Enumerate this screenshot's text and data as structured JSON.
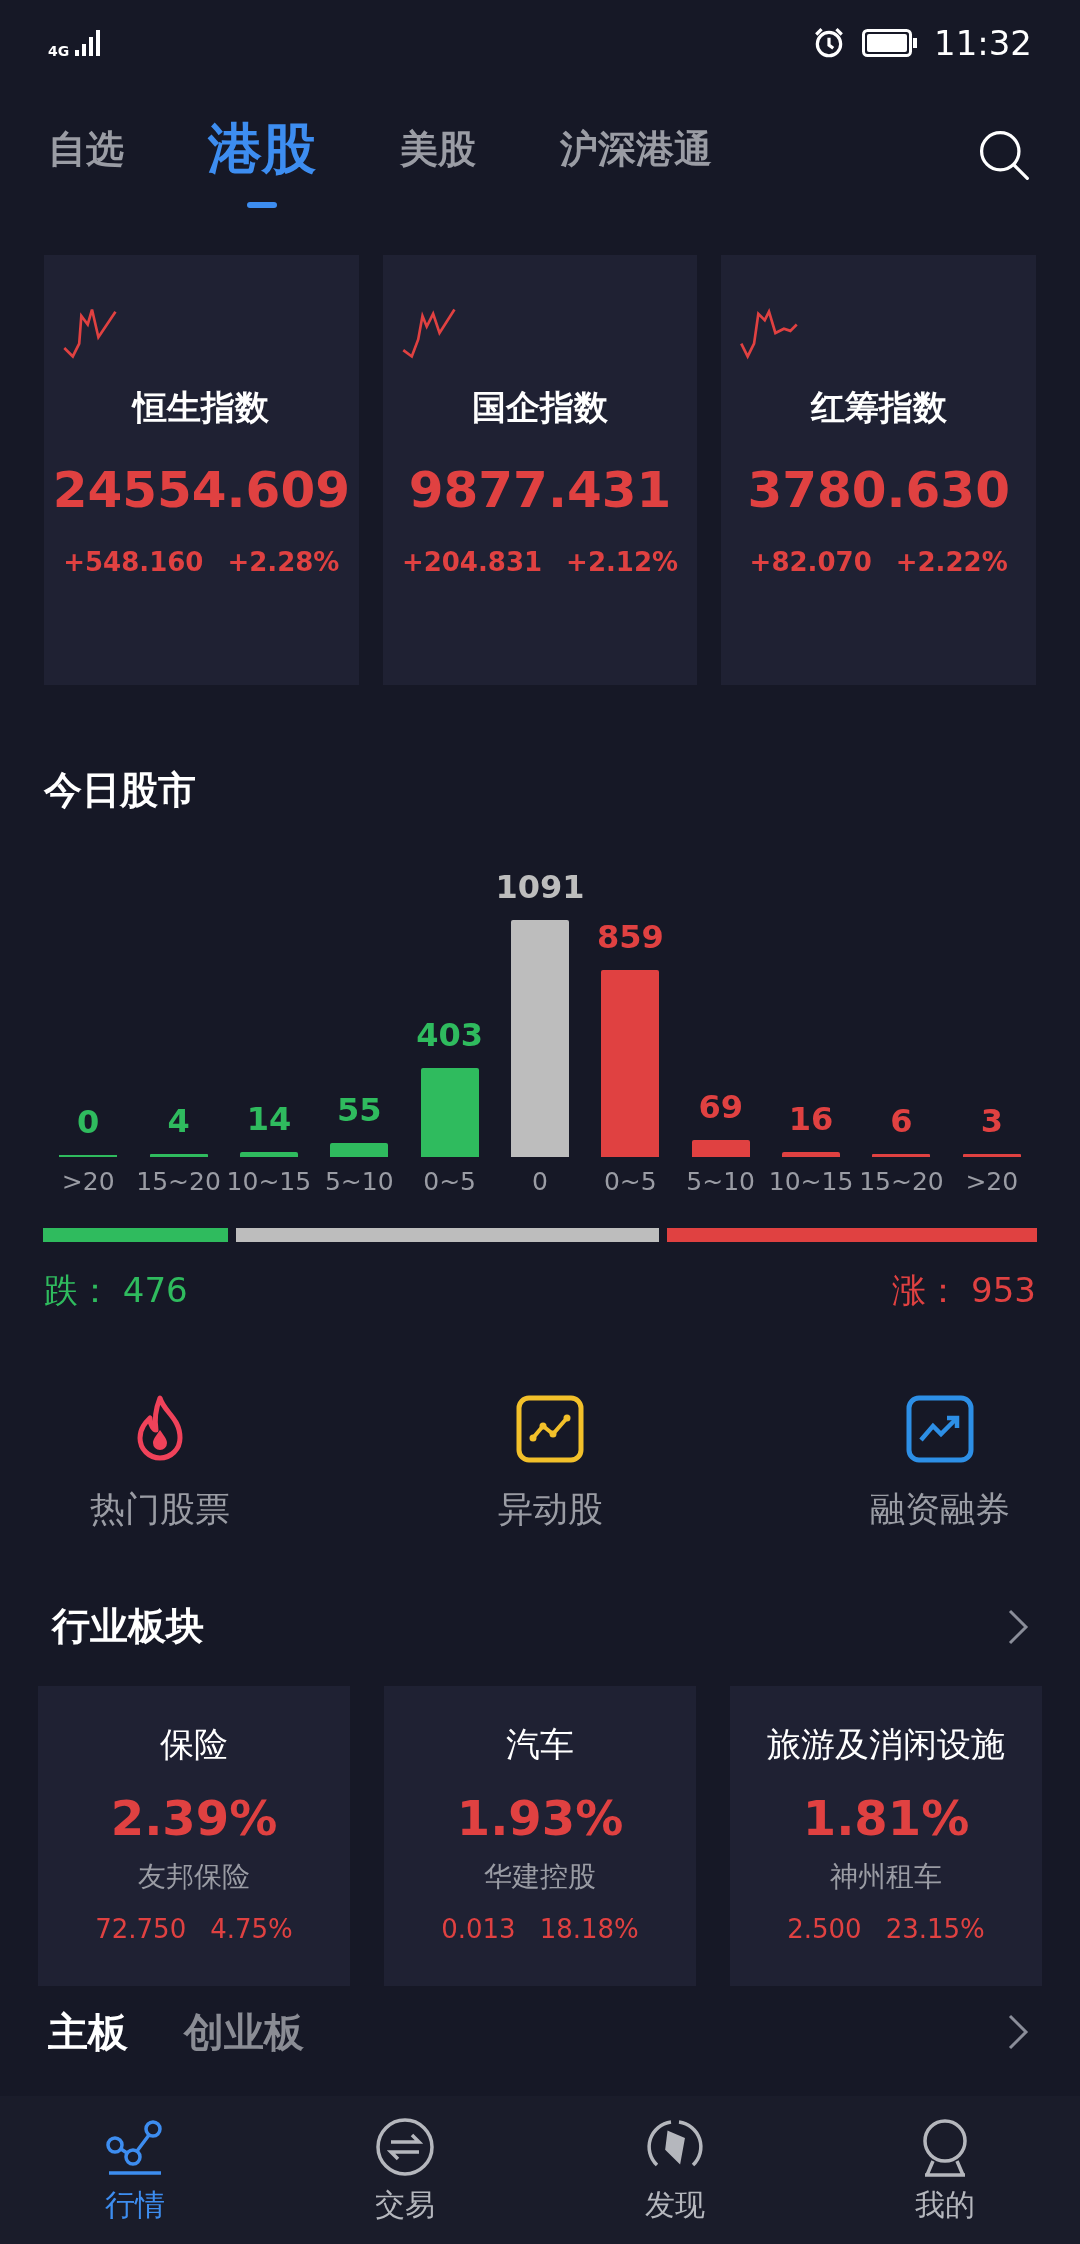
{
  "status_bar": {
    "network": "4G",
    "time": "11:32"
  },
  "tabs": [
    {
      "label": "自选",
      "selected": false
    },
    {
      "label": "港股",
      "selected": true
    },
    {
      "label": "美股",
      "selected": false
    },
    {
      "label": "沪深港通",
      "selected": false
    }
  ],
  "indices": [
    {
      "name": "恒生指数",
      "value": "24554.609",
      "change": "+548.160",
      "percent": "+2.28%"
    },
    {
      "name": "国企指数",
      "value": "9877.431",
      "change": "+204.831",
      "percent": "+2.12%"
    },
    {
      "name": "红筹指数",
      "value": "3780.630",
      "change": "+82.070",
      "percent": "+2.22%"
    }
  ],
  "market_today": {
    "title": "今日股市",
    "chart_data": {
      "type": "bar",
      "categories": [
        ">20",
        "15~20",
        "10~15",
        "5~10",
        "0~5",
        "0",
        "0~5",
        "5~10",
        "10~15",
        "15~20",
        ">20"
      ],
      "stacked": true,
      "data_labels": true,
      "series": [
        {
          "color": "#2fbb5e",
          "values": [
            0,
            4,
            14,
            55,
            403,
            null,
            null,
            null,
            null,
            null,
            null
          ]
        },
        {
          "color": "#bdbdbd",
          "values": [
            null,
            null,
            null,
            null,
            null,
            1091,
            null,
            null,
            null,
            null,
            null
          ]
        },
        {
          "color": "#e04141",
          "values": [
            null,
            null,
            null,
            null,
            null,
            null,
            859,
            69,
            16,
            6,
            3
          ]
        }
      ]
    },
    "down": {
      "label": "跌：",
      "count": "476"
    },
    "up": {
      "label": "涨：",
      "count": "953"
    }
  },
  "shortcuts": [
    {
      "kind": "fire",
      "label": "热门股票"
    },
    {
      "kind": "zigzag",
      "label": "异动股"
    },
    {
      "kind": "trend",
      "label": "融资融券"
    }
  ],
  "sectors": {
    "title": "行业板块",
    "items": [
      {
        "name": "保险",
        "percent": "2.39%",
        "leader": "友邦保险",
        "price": "72.750",
        "leader_percent": "4.75%"
      },
      {
        "name": "汽车",
        "percent": "1.93%",
        "leader": "华建控股",
        "price": "0.013",
        "leader_percent": "18.18%"
      },
      {
        "name": "旅游及消闲设施",
        "percent": "1.81%",
        "leader": "神州租车",
        "price": "2.500",
        "leader_percent": "23.15%"
      }
    ]
  },
  "board_tabs": [
    {
      "label": "主板",
      "selected": true
    },
    {
      "label": "创业板",
      "selected": false
    }
  ],
  "bottom_nav": [
    {
      "kind": "chart",
      "label": "行情",
      "selected": true
    },
    {
      "kind": "exchange",
      "label": "交易",
      "selected": false
    },
    {
      "kind": "compass",
      "label": "发现",
      "selected": false
    },
    {
      "kind": "user",
      "label": "我的",
      "selected": false
    }
  ]
}
